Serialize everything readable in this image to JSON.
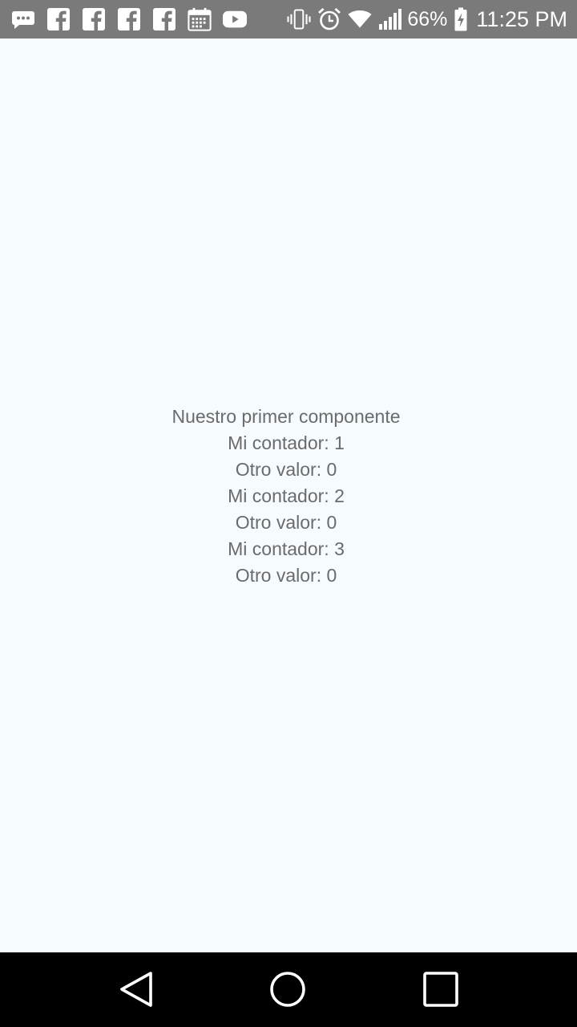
{
  "status_bar": {
    "battery_percent": "66%",
    "time": "11:25 PM",
    "icons": {
      "left": [
        "messaging-icon",
        "facebook-icon",
        "facebook-icon",
        "facebook-icon",
        "facebook-icon",
        "calendar-icon",
        "youtube-icon"
      ],
      "right": [
        "vibrate-icon",
        "alarm-icon",
        "wifi-icon",
        "signal-icon",
        "battery-charging-icon"
      ]
    }
  },
  "content": {
    "lines": [
      "Nuestro primer componente",
      "Mi contador: 1",
      "Otro valor: 0",
      "Mi contador: 2",
      "Otro valor: 0",
      "Mi contador: 3",
      "Otro valor: 0"
    ]
  },
  "navigation": {
    "buttons": [
      "back-icon",
      "home-icon",
      "recent-apps-icon"
    ]
  },
  "colors": {
    "status_bar_bg": "#7a7a7a",
    "background": "#f5fbff",
    "text": "#6b6b6b",
    "nav_bar_bg": "#000000"
  }
}
